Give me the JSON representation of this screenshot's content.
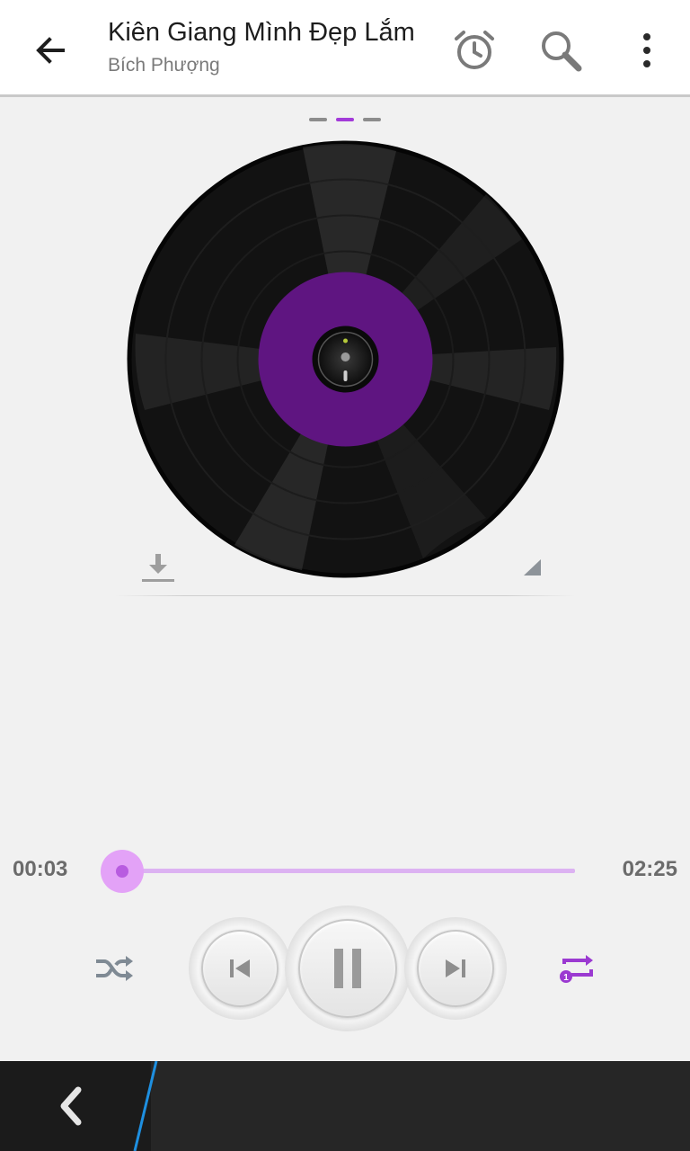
{
  "header": {
    "title": "Kiên Giang Mình Đẹp Lắm",
    "subtitle": "Bích Phượng",
    "icons": [
      "back-arrow-icon",
      "alarm-clock-icon",
      "search-icon",
      "more-vert-icon"
    ]
  },
  "pager": {
    "count": 3,
    "active_index": 1
  },
  "disc": {
    "label_color": "#5f1581"
  },
  "player": {
    "elapsed": "00:03",
    "total": "02:25",
    "progress_fraction": 0.02,
    "state": "playing",
    "shuffle": false,
    "repeat": "one",
    "repeat_badge": "1"
  },
  "colors": {
    "accent": "#a33bd9",
    "seek_track": "#dcb2f2",
    "seek_knob": "#e3a2f7",
    "repeat_active": "#9b3ad1",
    "nav_accent": "#1e8fe0"
  }
}
